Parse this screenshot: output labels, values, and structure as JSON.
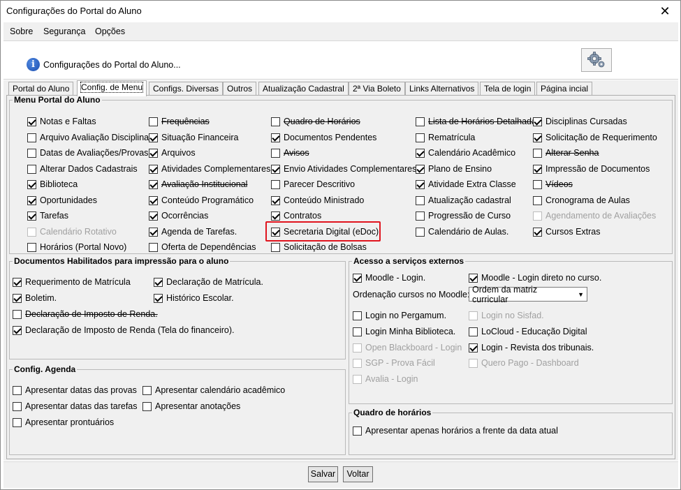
{
  "window": {
    "title": "Configurações do Portal do Aluno",
    "close": "✕"
  },
  "menubar": {
    "items": [
      "Sobre",
      "Segurança",
      "Opções"
    ]
  },
  "header": {
    "text": "Configurações do Portal do Aluno..."
  },
  "tabs": [
    "Portal do Aluno",
    "Config. de Menu",
    "Configs. Diversas",
    "Outros",
    "Atualização Cadastral",
    "2ª Via Boleto",
    "Links Alternativos",
    "Tela de login",
    "Página incial"
  ],
  "active_tab": "Config. de Menu",
  "menu_group": {
    "title": "Menu Portal do Aluno",
    "columns": [
      [
        {
          "label": "Notas e Faltas",
          "checked": true
        },
        {
          "label": "Arquivo Avaliação Disciplina",
          "checked": false
        },
        {
          "label": "Datas de Avaliações/Provas",
          "checked": false
        },
        {
          "label": "Alterar Dados Cadastrais",
          "checked": false
        },
        {
          "label": "Biblioteca",
          "checked": true
        },
        {
          "label": "Oportunidades",
          "checked": true
        },
        {
          "label": "Tarefas",
          "checked": true
        },
        {
          "label": "Calendário Rotativo",
          "checked": false,
          "disabled": true
        },
        {
          "label": "Horários (Portal Novo)",
          "checked": false
        }
      ],
      [
        {
          "label": "Frequências",
          "checked": false,
          "strike": true
        },
        {
          "label": "Situação Financeira",
          "checked": true
        },
        {
          "label": "Arquivos",
          "checked": true
        },
        {
          "label": "Atividades Complementares",
          "checked": true
        },
        {
          "label": "Avaliação Institucional",
          "checked": true,
          "strike": true
        },
        {
          "label": "Conteúdo Programático",
          "checked": true
        },
        {
          "label": "Ocorrências",
          "checked": true
        },
        {
          "label": "Agenda de Tarefas.",
          "checked": true
        },
        {
          "label": "Oferta de Dependências",
          "checked": false
        }
      ],
      [
        {
          "label": "Quadro de Horários",
          "checked": false,
          "strike": true
        },
        {
          "label": "Documentos Pendentes",
          "checked": true
        },
        {
          "label": "Avisos",
          "checked": false,
          "strike": true
        },
        {
          "label": "Envio Atividades Complementares",
          "checked": true
        },
        {
          "label": "Parecer Descritivo",
          "checked": false
        },
        {
          "label": "Conteúdo Ministrado",
          "checked": true
        },
        {
          "label": "Contratos",
          "checked": true
        },
        {
          "label": "Secretaria Digital (eDoc)",
          "checked": true,
          "highlight": true
        },
        {
          "label": "Solicitação de Bolsas",
          "checked": false
        }
      ],
      [
        {
          "label": "Lista de Horários Detalhada",
          "checked": false,
          "strike": true
        },
        {
          "label": "Rematrícula",
          "checked": false
        },
        {
          "label": "Calendário Acadêmico",
          "checked": true
        },
        {
          "label": "Plano de Ensino",
          "checked": true
        },
        {
          "label": "Atividade Extra Classe",
          "checked": true
        },
        {
          "label": "Atualização cadastral",
          "checked": false
        },
        {
          "label": "Progressão de Curso",
          "checked": false
        },
        {
          "label": "Calendário de Aulas.",
          "checked": false
        }
      ],
      [
        {
          "label": "Disciplinas Cursadas",
          "checked": true
        },
        {
          "label": "Solicitação de Requerimento",
          "checked": true
        },
        {
          "label": "Alterar Senha",
          "checked": false,
          "strike": true
        },
        {
          "label": "Impressão de Documentos",
          "checked": true
        },
        {
          "label": "Vídeos",
          "checked": false,
          "strike": true
        },
        {
          "label": "Cronograma de Aulas",
          "checked": false
        },
        {
          "label": "Agendamento de Avaliações",
          "checked": false,
          "disabled": true
        },
        {
          "label": "Cursos Extras",
          "checked": true
        }
      ]
    ]
  },
  "docs_group": {
    "title": "Documentos Habilitados para impressão para o aluno",
    "items": [
      {
        "label": "Requerimento de Matrícula",
        "checked": true
      },
      {
        "label": "Declaração de Matrícula.",
        "checked": true
      },
      {
        "label": "Boletim.",
        "checked": true
      },
      {
        "label": "Histórico Escolar.",
        "checked": true
      },
      {
        "label": "Declaração de Imposto de Renda.",
        "checked": false,
        "strike": true
      },
      {
        "label": "Declaração de Imposto de Renda (Tela do financeiro).",
        "checked": true
      }
    ]
  },
  "agenda_group": {
    "title": "Config. Agenda",
    "items": [
      {
        "label": "Apresentar datas das provas",
        "checked": false
      },
      {
        "label": "Apresentar calendário acadêmico",
        "checked": false
      },
      {
        "label": "Apresentar datas das tarefas",
        "checked": false
      },
      {
        "label": "Apresentar anotações",
        "checked": false
      },
      {
        "label": "Apresentar prontuários",
        "checked": false
      }
    ]
  },
  "external_group": {
    "title": "Acesso a serviços externos",
    "moodle_login": {
      "label": "Moodle - Login.",
      "checked": true
    },
    "moodle_direct": {
      "label": "Moodle - Login direto no curso.",
      "checked": true
    },
    "order_label": "Ordenação cursos no Moodle:",
    "order_value": "Ordem da matriz curricular",
    "items": [
      {
        "label": "Login no Pergamum.",
        "checked": false
      },
      {
        "label": "Login no Sisfad.",
        "checked": false,
        "disabled": true
      },
      {
        "label": "Login Minha Biblioteca.",
        "checked": false
      },
      {
        "label": "LoCloud - Educação Digital",
        "checked": false
      },
      {
        "label": "Open Blackboard - Login",
        "checked": false,
        "disabled": true
      },
      {
        "label": "Login - Revista dos tribunais.",
        "checked": true
      },
      {
        "label": "SGP - Prova Fácil",
        "checked": false,
        "disabled": true
      },
      {
        "label": "Quero Pago - Dashboard",
        "checked": false,
        "disabled": true
      },
      {
        "label": "Avalia - Login",
        "checked": false,
        "disabled": true
      }
    ]
  },
  "schedule_group": {
    "title": "Quadro de horários",
    "item": {
      "label": "Apresentar apenas horários a frente da data atual",
      "checked": false
    }
  },
  "footer": {
    "save": "Salvar",
    "back": "Voltar"
  },
  "colors": {
    "highlight": "#e0141e",
    "panel": "#f0f0f0",
    "info_icon": "#1c4fb0"
  }
}
